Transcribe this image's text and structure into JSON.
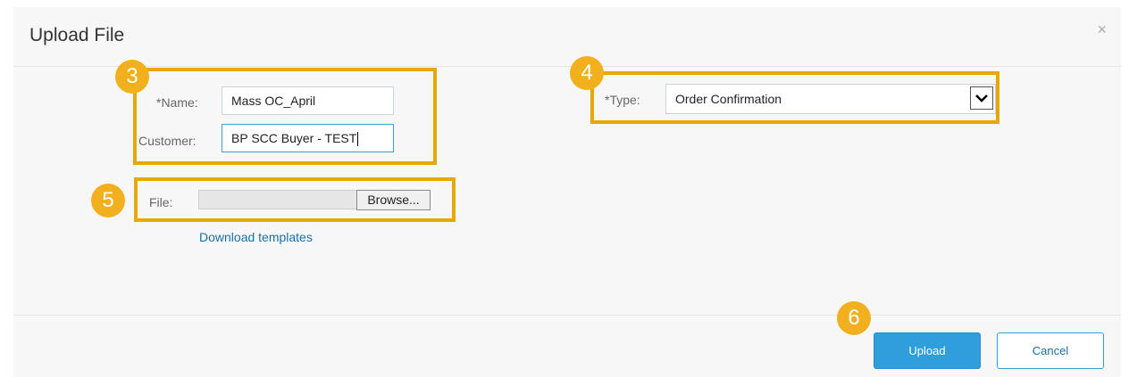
{
  "dialog": {
    "title": "Upload File",
    "close_glyph": "×"
  },
  "form": {
    "name_label": "*Name:",
    "name_value": "Mass OC_April",
    "customer_label": "Customer:",
    "customer_value": "BP SCC Buyer - TEST",
    "type_label": "*Type:",
    "type_value": "Order Confirmation",
    "file_label": "File:",
    "browse_label": "Browse...",
    "download_link": "Download templates"
  },
  "footer": {
    "upload_label": "Upload",
    "cancel_label": "Cancel"
  },
  "callouts": {
    "c3": "3",
    "c4": "4",
    "c5": "5",
    "c6": "6",
    "color": "#e8a800"
  },
  "colors": {
    "primary": "#2f9edb",
    "link": "#1a6fa8"
  }
}
